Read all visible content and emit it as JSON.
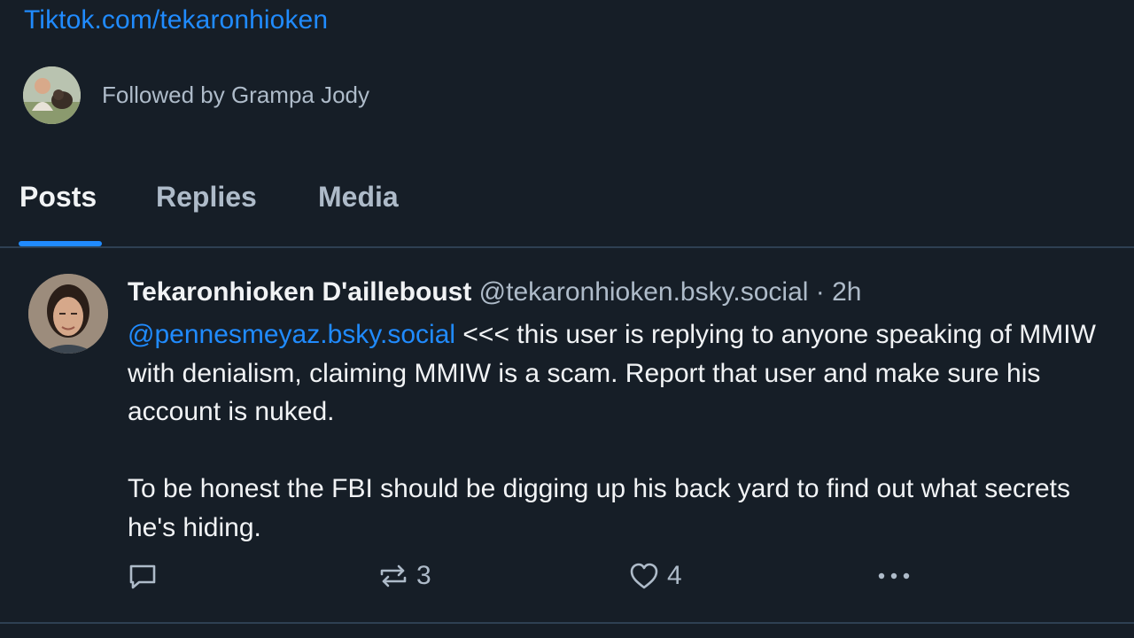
{
  "profile": {
    "link": "Tiktok.com/tekaronhioken",
    "followed_by": "Followed by Grampa Jody"
  },
  "tabs": [
    {
      "label": "Posts",
      "active": true
    },
    {
      "label": "Replies",
      "active": false
    },
    {
      "label": "Media",
      "active": false
    }
  ],
  "post": {
    "author_name": "Tekaronhioken D'ailleboust",
    "author_handle": "@tekaronhioken.bsky.social",
    "separator": " · ",
    "time": "2h",
    "mention": "@pennesmeyaz.bsky.social",
    "text_part1": " <<< this user is replying to anyone speaking of MMIW with denialism, claiming MMIW is a scam. Report that user and make sure his account is nuked.",
    "text_part2": "To be honest the FBI should be digging up his back yard to find out what secrets he's hiding.",
    "reply_count": "",
    "repost_count": "3",
    "like_count": "4"
  },
  "icons": {
    "reply": "reply-bubble-icon",
    "repost": "repost-icon",
    "like": "heart-icon",
    "more": "more-dots-icon"
  },
  "colors": {
    "background": "#161e27",
    "accent": "#208bfe",
    "text_primary": "#f1f3f5",
    "text_secondary": "#aebbc9",
    "divider": "#2e4052"
  }
}
